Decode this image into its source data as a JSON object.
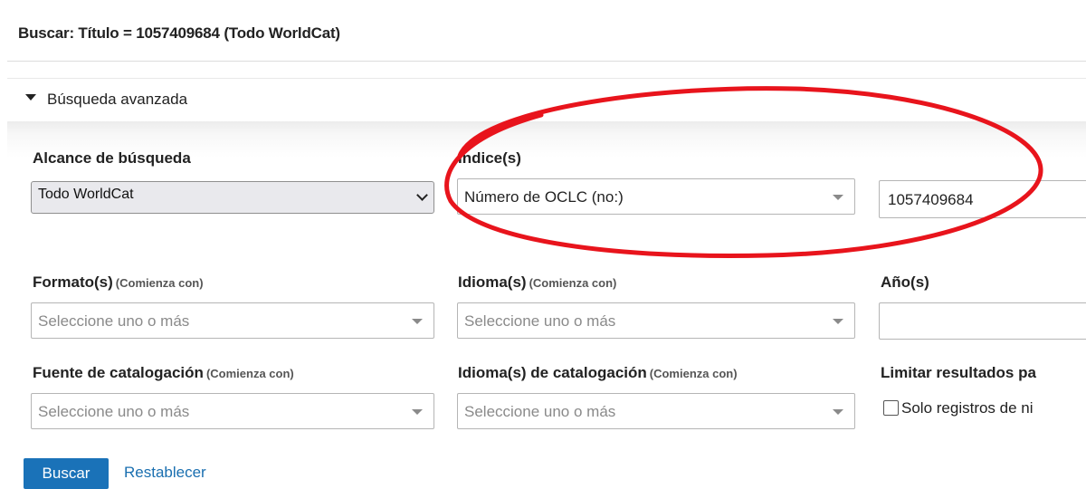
{
  "header": {
    "title": "Buscar: Título = 1057409684 (Todo WorldCat)"
  },
  "advanced_search": {
    "toggle_label": "Búsqueda avanzada",
    "expanded": true
  },
  "search_scope": {
    "label": "Alcance de búsqueda",
    "selected": "Todo WorldCat"
  },
  "index": {
    "label": "Indice(s)",
    "selected": "Número de OCLC (no:)",
    "term_value": "1057409684"
  },
  "formats": {
    "label": "Formato(s)",
    "hint": "(Comienza con)",
    "placeholder": "Seleccione uno o más"
  },
  "languages": {
    "label": "Idioma(s)",
    "hint": "(Comienza con)",
    "placeholder": "Seleccione uno o más"
  },
  "years": {
    "label": "Año(s)",
    "value": ""
  },
  "cataloging_source": {
    "label": "Fuente de catalogación",
    "hint": "(Comienza con)",
    "placeholder": "Seleccione uno o más"
  },
  "cataloging_language": {
    "label": "Idioma(s) de catalogación",
    "hint": "(Comienza con)",
    "placeholder": "Seleccione uno o más"
  },
  "limit_results": {
    "label": "Limitar resultados pa",
    "checkbox_label": "Solo registros de ni",
    "checked": false
  },
  "actions": {
    "search_label": "Buscar",
    "reset_label": "Restablecer"
  },
  "colors": {
    "primary": "#1a72b8",
    "link": "#1a6fb0",
    "annotation": "#e8141c"
  }
}
